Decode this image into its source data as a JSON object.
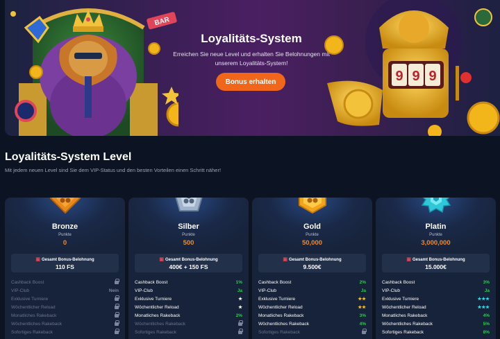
{
  "hero": {
    "title": "Loyalitäts-System",
    "subtitle_line1": "Erreichen Sie neue Level und erhalten Sie Belohnungen mit",
    "subtitle_line2": "unserem Loyalitäts-System!",
    "cta_label": "Bonus erhalten",
    "illustration_left_sign": "BAR",
    "slot_reels": [
      "9",
      "9",
      "9"
    ]
  },
  "section": {
    "title": "Loyalitäts-System Level",
    "subtitle": "Mit jedem neuen Level sind Sie dem VIP-Status und den besten Vorteilen einen Schritt näher!"
  },
  "levels": [
    {
      "name": "Bronze",
      "points_label": "Punkte",
      "points": "0",
      "reward_label": "Gesamt Bonus-Belohnung",
      "reward_value": "110 FS",
      "badge_color": "#e88a1a",
      "benefits": [
        {
          "label": "Cashback Boost",
          "value": "",
          "icon": "lock-icon"
        },
        {
          "label": "VIP-Club",
          "value": "Nein",
          "icon": ""
        },
        {
          "label": "Exklusive Turniere",
          "value": "",
          "icon": "lock-icon"
        },
        {
          "label": "Wöchentlicher Reload",
          "value": "",
          "icon": "lock-icon"
        },
        {
          "label": "Monatliches Rakeback",
          "value": "",
          "icon": "lock-icon"
        },
        {
          "label": "Wöchentliches Rakeback",
          "value": "",
          "icon": "lock-icon"
        },
        {
          "label": "Sofortiges Rakeback",
          "value": "",
          "icon": "lock-icon"
        }
      ]
    },
    {
      "name": "Silber",
      "points_label": "Punkte",
      "points": "500",
      "reward_label": "Gesamt Bonus-Belohnung",
      "reward_value": "400€ + 150 FS",
      "badge_color": "#9fb3cc",
      "benefits": [
        {
          "label": "Cashback Boost",
          "value": "1%",
          "icon": ""
        },
        {
          "label": "VIP-Club",
          "value": "Ja",
          "icon": ""
        },
        {
          "label": "Exklusive Turniere",
          "value": "★",
          "icon": ""
        },
        {
          "label": "Wöchentlicher Reload",
          "value": "★",
          "icon": ""
        },
        {
          "label": "Monatliches Rakeback",
          "value": "2%",
          "icon": ""
        },
        {
          "label": "Wöchentliches Rakeback",
          "value": "",
          "icon": "lock-icon"
        },
        {
          "label": "Sofortiges Rakeback",
          "value": "",
          "icon": "lock-icon"
        }
      ]
    },
    {
      "name": "Gold",
      "points_label": "Punkte",
      "points": "50,000",
      "reward_label": "Gesamt Bonus-Belohnung",
      "reward_value": "9.500€",
      "badge_color": "#f2a51a",
      "benefits": [
        {
          "label": "Cashback Boost",
          "value": "2%",
          "icon": ""
        },
        {
          "label": "VIP-Club",
          "value": "Ja",
          "icon": ""
        },
        {
          "label": "Exklusive Turniere",
          "value": "★★",
          "icon": ""
        },
        {
          "label": "Wöchentlicher Reload",
          "value": "★★",
          "icon": ""
        },
        {
          "label": "Monatliches Rakeback",
          "value": "3%",
          "icon": ""
        },
        {
          "label": "Wöchentliches Rakeback",
          "value": "4%",
          "icon": ""
        },
        {
          "label": "Sofortiges Rakeback",
          "value": "",
          "icon": "lock-icon"
        }
      ]
    },
    {
      "name": "Platin",
      "points_label": "Punkte",
      "points": "3,000,000",
      "reward_label": "Gesamt Bonus-Belohnung",
      "reward_value": "15.000€",
      "badge_color": "#2fc8d8",
      "benefits": [
        {
          "label": "Cashback Boost",
          "value": "3%",
          "icon": ""
        },
        {
          "label": "VIP-Club",
          "value": "Ja",
          "icon": ""
        },
        {
          "label": "Exklusive Turniere",
          "value": "★★★",
          "icon": ""
        },
        {
          "label": "Wöchentlicher Reload",
          "value": "★★★",
          "icon": ""
        },
        {
          "label": "Monatliches Rakeback",
          "value": "4%",
          "icon": ""
        },
        {
          "label": "Wöchentliches Rakeback",
          "value": "5%",
          "icon": ""
        },
        {
          "label": "Sofortiges Rakeback",
          "value": "8%",
          "icon": ""
        }
      ]
    }
  ],
  "colors": {
    "accent": "#f0661a",
    "points": "#f08a2a",
    "positive": "#2fcb53",
    "star_gold": "#f2c33a",
    "star_cyan": "#39d6e6"
  }
}
